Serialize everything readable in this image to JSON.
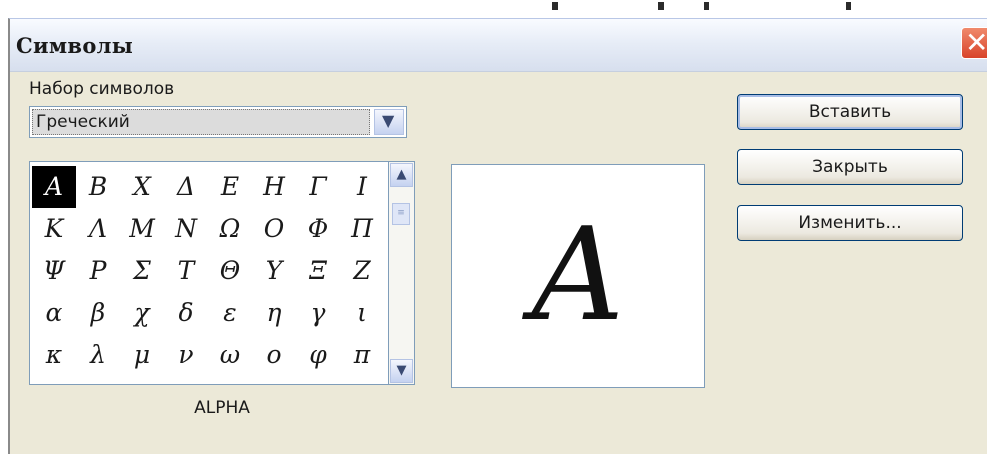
{
  "window": {
    "title": "Символы"
  },
  "charset": {
    "label": "Набор символов",
    "selected": "Греческий"
  },
  "symbols": {
    "rows": [
      [
        "Α",
        "Β",
        "Χ",
        "Δ",
        "Ε",
        "Η",
        "Γ",
        "Ι"
      ],
      [
        "Κ",
        "Λ",
        "Μ",
        "Ν",
        "Ω",
        "Ο",
        "Φ",
        "Π"
      ],
      [
        "Ψ",
        "Ρ",
        "Σ",
        "Τ",
        "Θ",
        "Υ",
        "Ξ",
        "Ζ"
      ],
      [
        "α",
        "β",
        "χ",
        "δ",
        "ε",
        "η",
        "γ",
        "ι"
      ],
      [
        "κ",
        "λ",
        "μ",
        "ν",
        "ω",
        "ο",
        "φ",
        "π"
      ]
    ],
    "selected_row": 0,
    "selected_col": 0
  },
  "preview": {
    "char": "A"
  },
  "char_name": "ALPHA",
  "buttons": {
    "insert": "Вставить",
    "close": "Закрыть",
    "modify": "Изменить..."
  },
  "colors": {
    "close_button": "#d8432a",
    "selection": "#000000",
    "border": "#7f9db9"
  },
  "icons": {
    "close": "close-icon",
    "dropdown": "chevron-down-icon",
    "scroll_up": "chevron-up-icon",
    "scroll_down": "chevron-down-icon"
  }
}
